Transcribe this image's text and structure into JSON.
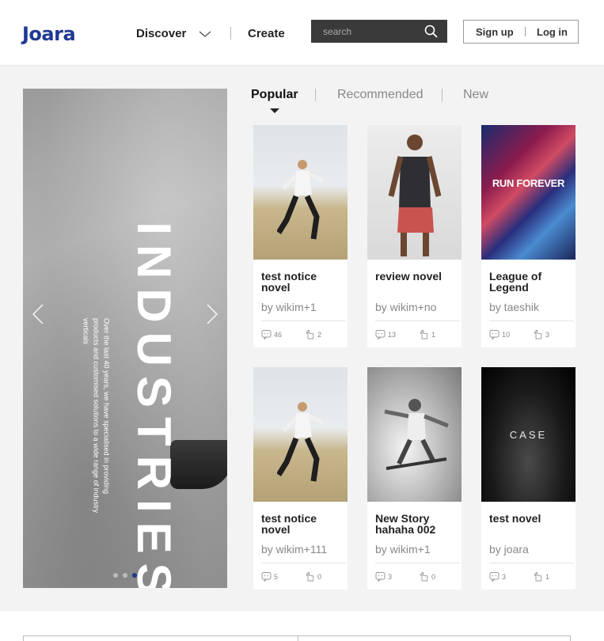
{
  "header": {
    "logo": "Joara",
    "nav": {
      "discover": "Discover",
      "create": "Create"
    },
    "search_placeholder": "search",
    "auth": {
      "signup": "Sign up",
      "login": "Log in"
    }
  },
  "banner": {
    "title": "INDUSTRIES",
    "description": "Over the last 40 years, we have specialised in providing products and customised solutions to a wide range of industry verticals",
    "slides": 3,
    "active_slide": 3
  },
  "tabs": [
    {
      "label": "Popular",
      "active": true
    },
    {
      "label": "Recommended",
      "active": false
    },
    {
      "label": "New",
      "active": false
    }
  ],
  "cards": [
    {
      "title": "test notice novel",
      "author": "by wikim+1",
      "comments": "46",
      "likes": "2",
      "cover": "runner"
    },
    {
      "title": "review novel",
      "author": "by wikim+no",
      "comments": "13",
      "likes": "1",
      "cover": "athlete"
    },
    {
      "title": "League of Legend",
      "author": "by taeshik",
      "comments": "10",
      "likes": "3",
      "cover": "run-forever",
      "cover_text": "RUN FOREVER"
    },
    {
      "title": "test notice novel",
      "author": "by wikim+111",
      "comments": "5",
      "likes": "0",
      "cover": "runner"
    },
    {
      "title": "New Story hahaha 002",
      "author": "by wikim+1",
      "comments": "3",
      "likes": "0",
      "cover": "surf"
    },
    {
      "title": "test novel",
      "author": "by joara",
      "comments": "3",
      "likes": "1",
      "cover": "case",
      "cover_text": "CASE"
    }
  ],
  "colors": {
    "brand": "#1f3a93",
    "accent": "#7cc243",
    "search_bg": "#3a3a3a"
  }
}
